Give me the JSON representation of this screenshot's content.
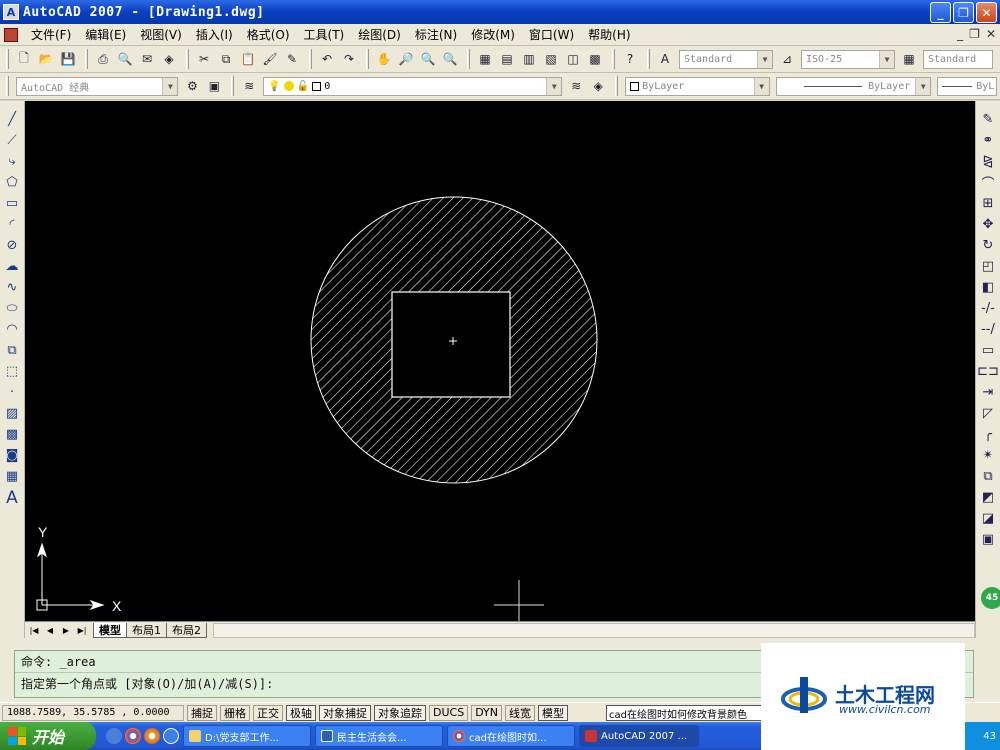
{
  "window": {
    "title": "AutoCAD 2007 - [Drawing1.dwg]",
    "app_icon": "A"
  },
  "menu": [
    "文件(F)",
    "编辑(E)",
    "视图(V)",
    "插入(I)",
    "格式(O)",
    "工具(T)",
    "绘图(D)",
    "标注(N)",
    "修改(M)",
    "窗口(W)",
    "帮助(H)"
  ],
  "toolbar": {
    "text_style": "Standard",
    "dim_style": "ISO-25",
    "table_style": "Standard",
    "workspace": "AutoCAD 经典",
    "layer": "0",
    "color": "ByLayer",
    "linetype": "ByLayer",
    "lineweight": "ByL"
  },
  "canvas": {
    "y_axis_label": "Y",
    "x_axis_label": "X"
  },
  "layout_tabs": [
    "模型",
    "布局1",
    "布局2"
  ],
  "command": {
    "history": "命令: _area",
    "prompt": "指定第一个角点或 [对象(O)/加(A)/减(S)]:"
  },
  "status": {
    "coords": "1088.7589, 35.5785 , 0.0000",
    "buttons": [
      "捕捉",
      "栅格",
      "正交",
      "极轴",
      "对象捕捉",
      "对象追踪",
      "DUCS",
      "DYN",
      "线宽",
      "模型"
    ],
    "search": "cad在绘图时如何修改背景颜色"
  },
  "taskbar": {
    "start_label": "开始",
    "tasks": [
      "D:\\党支部工作...",
      "民主生活会会...",
      "cad在绘图时如...",
      "AutoCAD 2007 ..."
    ],
    "clock": "43"
  },
  "watermark": {
    "title": "土木工程网",
    "url": "www.civilcn.com"
  },
  "zoom_badge": "45"
}
